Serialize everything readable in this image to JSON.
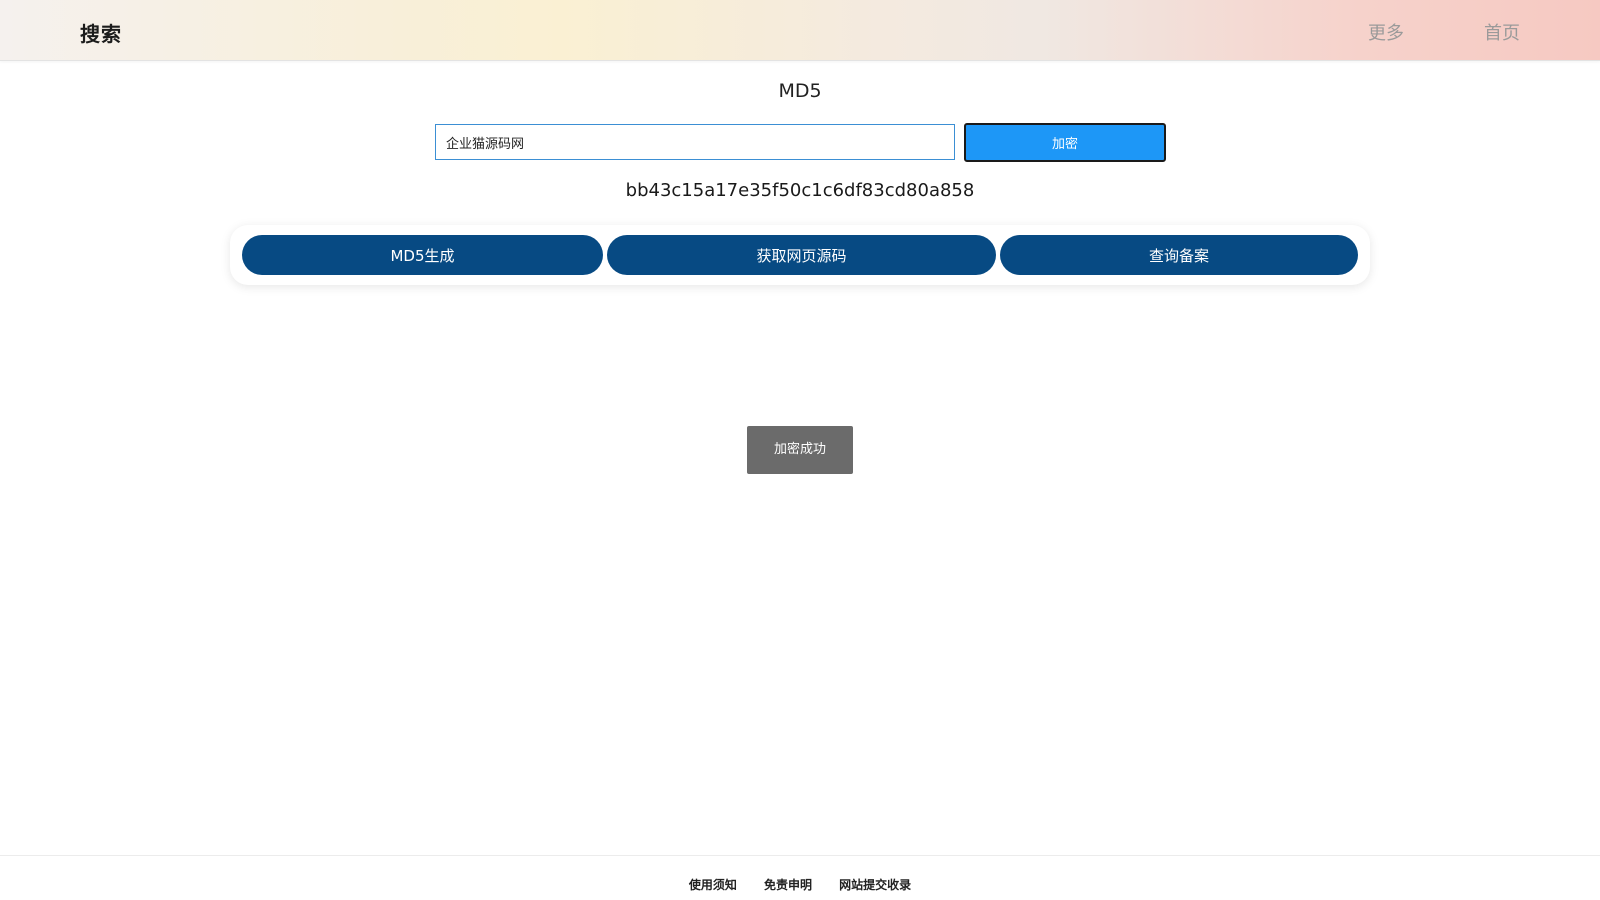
{
  "header": {
    "brand": "搜索",
    "nav": [
      {
        "label": "更多"
      },
      {
        "label": "首页"
      }
    ]
  },
  "main": {
    "title": "MD5",
    "input_value": "企业猫源码网",
    "encrypt_label": "加密",
    "hash_result": "bb43c15a17e35f50c1c6df83cd80a858",
    "tabs": [
      {
        "label": "MD5生成"
      },
      {
        "label": "获取网页源码"
      },
      {
        "label": "查询备案"
      }
    ],
    "toast": "加密成功"
  },
  "footer": {
    "links": [
      {
        "label": "使用须知"
      },
      {
        "label": "免责申明"
      },
      {
        "label": "网站提交收录"
      }
    ]
  },
  "colors": {
    "tab_bg": "#074a83",
    "encrypt_bg": "#1d97f7",
    "toast_bg": "#6b6b6b"
  }
}
